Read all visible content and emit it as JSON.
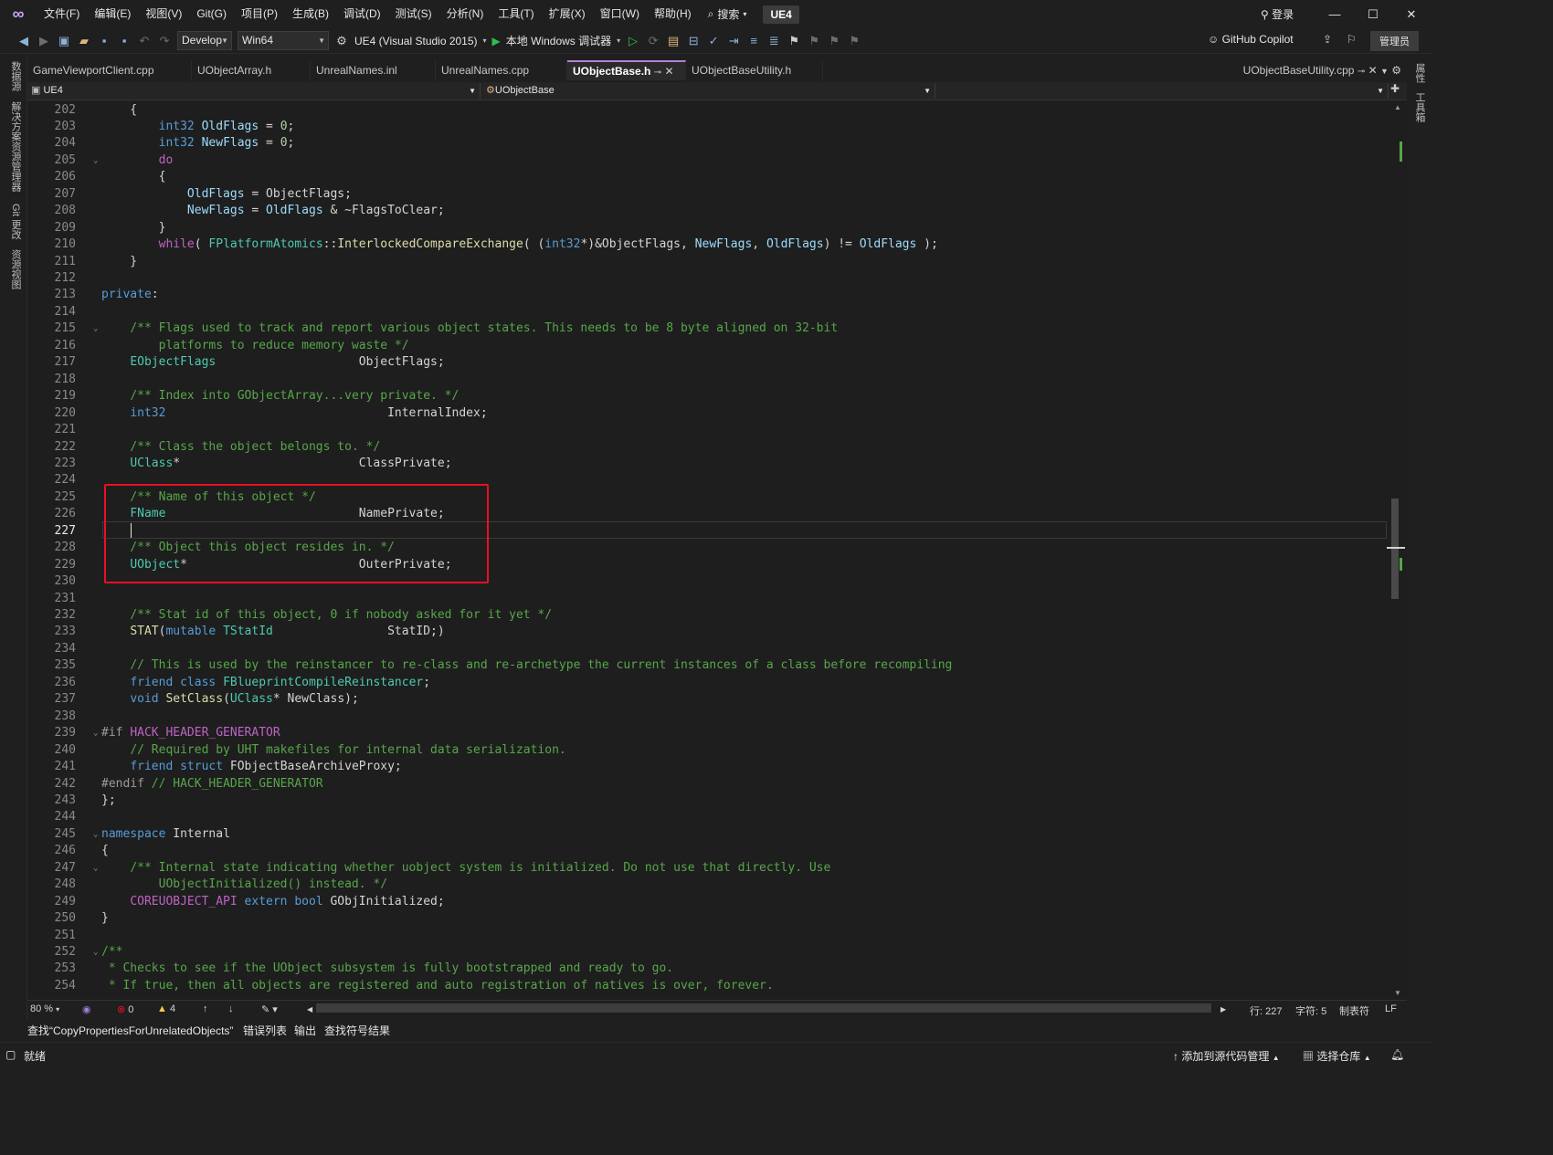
{
  "titlebar": {
    "menus": [
      "文件(F)",
      "编辑(E)",
      "视图(V)",
      "Git(G)",
      "项目(P)",
      "生成(B)",
      "调试(D)",
      "测试(S)",
      "分析(N)",
      "工具(T)",
      "扩展(X)",
      "窗口(W)",
      "帮助(H)"
    ],
    "search_label": "搜索",
    "solution_name": "UE4",
    "login_label": "登录"
  },
  "toolbar": {
    "config": "Develop",
    "platform": "Win64",
    "startup_project": "UE4 (Visual Studio 2015)",
    "debug_target": "本地 Windows 调试器",
    "copilot_label": "GitHub Copilot",
    "admin_label": "管理员"
  },
  "left_strip": [
    "数据源",
    "解决方案资源管理器",
    "Git 更改",
    "资源视图"
  ],
  "right_strip": [
    "属性",
    "工具箱"
  ],
  "tabs": [
    "GameViewportClient.cpp",
    "UObjectArray.h",
    "UnrealNames.inl",
    "UnrealNames.cpp",
    "UObjectBase.h",
    "UObjectBaseUtility.h"
  ],
  "active_tab": "UObjectBase.h",
  "right_tab": "UObjectBaseUtility.cpp",
  "navbar": {
    "project": "UE4",
    "scope": "UObjectBase"
  },
  "code_lines": [
    {
      "n": "202",
      "h": "    {"
    },
    {
      "n": "203",
      "h": "        <span class=kw>int32</span> <span class=va>OldFlags</span> = <span class=nu>0</span>;"
    },
    {
      "n": "204",
      "h": "        <span class=kw>int32</span> <span class=va>NewFlags</span> = <span class=nu>0</span>;"
    },
    {
      "n": "205",
      "h": "        <span class=ma>do</span>",
      "f": true
    },
    {
      "n": "206",
      "h": "        {"
    },
    {
      "n": "207",
      "h": "            <span class=va>OldFlags</span> = ObjectFlags;"
    },
    {
      "n": "208",
      "h": "            <span class=va>NewFlags</span> = <span class=va>OldFlags</span> &amp; ~FlagsToClear;"
    },
    {
      "n": "209",
      "h": "        }"
    },
    {
      "n": "210",
      "h": "        <span class=ma>while</span>( <span class=ty>FPlatformAtomics</span>::<span class=fn>InterlockedCompareExchange</span>( (<span class=kw>int32</span>*)&amp;ObjectFlags, <span class=va>NewFlags</span>, <span class=va>OldFlags</span>) != <span class=va>OldFlags</span> );"
    },
    {
      "n": "211",
      "h": "    }"
    },
    {
      "n": "212",
      "h": ""
    },
    {
      "n": "213",
      "h": "<span class=kw>private</span>:"
    },
    {
      "n": "214",
      "h": ""
    },
    {
      "n": "215",
      "h": "    <span class=cm>/** Flags used to track and report various object states. This needs to be 8 byte aligned on 32-bit</span>",
      "f": true
    },
    {
      "n": "216",
      "h": "<span class=cm>        platforms to reduce memory waste */</span>"
    },
    {
      "n": "217",
      "h": "    <span class=ty>EObjectFlags</span>                    ObjectFlags;"
    },
    {
      "n": "218",
      "h": ""
    },
    {
      "n": "219",
      "h": "    <span class=cm>/** Index into GObjectArray...very private. */</span>"
    },
    {
      "n": "220",
      "h": "    <span class=kw>int32</span>                               InternalIndex;"
    },
    {
      "n": "221",
      "h": ""
    },
    {
      "n": "222",
      "h": "    <span class=cm>/** Class the object belongs to. */</span>"
    },
    {
      "n": "223",
      "h": "    <span class=ty>UClass</span>*                         ClassPrivate;"
    },
    {
      "n": "224",
      "h": ""
    },
    {
      "n": "225",
      "h": "    <span class=cm>/** Name of this object */</span>"
    },
    {
      "n": "226",
      "h": "    <span class=ty>FName</span>                           NamePrivate;"
    },
    {
      "n": "227",
      "h": "",
      "cur": true
    },
    {
      "n": "228",
      "h": "    <span class=cm>/** Object this object resides in. */</span>"
    },
    {
      "n": "229",
      "h": "    <span class=ty>UObject</span>*                        OuterPrivate;"
    },
    {
      "n": "230",
      "h": ""
    },
    {
      "n": "231",
      "h": ""
    },
    {
      "n": "232",
      "h": "    <span class=cm>/** Stat id of this object, 0 if nobody asked for it yet */</span>"
    },
    {
      "n": "233",
      "h": "    <span class=fn>STAT</span>(<span class=kw>mutable</span> <span class=ty>TStatId</span>                StatID;)"
    },
    {
      "n": "234",
      "h": ""
    },
    {
      "n": "235",
      "h": "    <span class=cm>// This is used by the reinstancer to re-class and re-archetype the current instances of a class before recompiling</span>"
    },
    {
      "n": "236",
      "h": "    <span class=kw>friend</span> <span class=kw>class</span> <span class=ty>FBlueprintCompileReinstancer</span>;"
    },
    {
      "n": "237",
      "h": "    <span class=kw>void</span> <span class=fn>SetClass</span>(<span class=ty>UClass</span>* NewClass);"
    },
    {
      "n": "238",
      "h": ""
    },
    {
      "n": "239",
      "h": "<span class=pp>#if</span> <span class=ma>HACK_HEADER_GENERATOR</span>",
      "f": true
    },
    {
      "n": "240",
      "h": "    <span class=cm>// Required by UHT makefiles for internal data serialization.</span>"
    },
    {
      "n": "241",
      "h": "    <span class=kw>friend</span> <span class=kw>struct</span> FObjectBaseArchiveProxy;"
    },
    {
      "n": "242",
      "h": "<span class=pp>#endif</span> <span class=cm>// HACK_HEADER_GENERATOR</span>"
    },
    {
      "n": "243",
      "h": "};"
    },
    {
      "n": "244",
      "h": ""
    },
    {
      "n": "245",
      "h": "<span class=kw>namespace</span> Internal",
      "f": true
    },
    {
      "n": "246",
      "h": "{"
    },
    {
      "n": "247",
      "h": "    <span class=cm>/** Internal state indicating whether uobject system is initialized. Do not use that directly. Use</span>",
      "f": true
    },
    {
      "n": "248",
      "h": "<span class=cm>        UObjectInitialized() instead. */</span>"
    },
    {
      "n": "249",
      "h": "    <span class=ma>COREUOBJECT_API</span> <span class=kw>extern</span> <span class=kw>bool</span> GObjInitialized;"
    },
    {
      "n": "250",
      "h": "}"
    },
    {
      "n": "251",
      "h": ""
    },
    {
      "n": "252",
      "h": "<span class=cm>/**</span>",
      "f": true
    },
    {
      "n": "253",
      "h": "<span class=cm> * Checks to see if the UObject subsystem is fully bootstrapped and ready to go.</span>"
    },
    {
      "n": "254",
      "h": "<span class=cm> * If true, then all objects are registered and auto registration of natives is over, forever.</span>"
    }
  ],
  "editor_status": {
    "zoom": "80 %",
    "errors": "0",
    "warnings": "4",
    "line": "行: 227",
    "col": "字符: 5",
    "indent": "制表符",
    "eol": "LF"
  },
  "bottom_tabs": [
    "查找“CopyPropertiesForUnrelatedObjects”",
    "错误列表",
    "输出",
    "查找符号结果"
  ],
  "statusbar": {
    "ready": "就绪",
    "add_source": "添加到源代码管理",
    "select_repo": "选择仓库"
  },
  "colors": {
    "accent": "#b180d7",
    "highlight_box": "#e81123",
    "background": "#1e1e1e"
  }
}
